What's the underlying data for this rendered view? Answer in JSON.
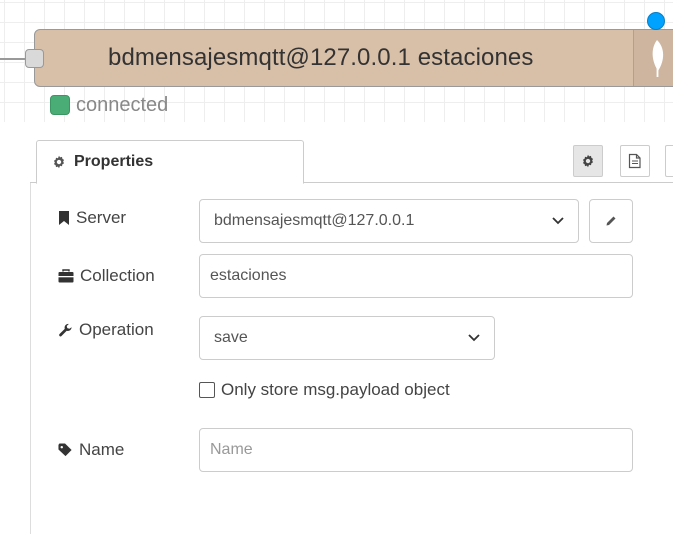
{
  "node": {
    "label": "bdmensajesmqtt@127.0.0.1 estaciones",
    "status_text": "connected",
    "status_color": "#4aad75",
    "node_color": "#d8bfa8",
    "icon": "leaf-icon"
  },
  "tabs": {
    "properties_label": "Properties",
    "properties_icon": "gear-icon",
    "side_buttons": [
      "gear-icon",
      "document-icon"
    ]
  },
  "form": {
    "server": {
      "label": "Server",
      "icon": "bookmark-icon",
      "value": "bdmensajesmqtt@127.0.0.1",
      "edit_icon": "pencil-icon"
    },
    "collection": {
      "label": "Collection",
      "icon": "briefcase-icon",
      "value": "estaciones"
    },
    "operation": {
      "label": "Operation",
      "icon": "wrench-icon",
      "value": "save"
    },
    "payload_only": {
      "label": "Only store msg.payload object",
      "checked": false
    },
    "name": {
      "label": "Name",
      "icon": "tag-icon",
      "value": "",
      "placeholder": "Name"
    }
  }
}
